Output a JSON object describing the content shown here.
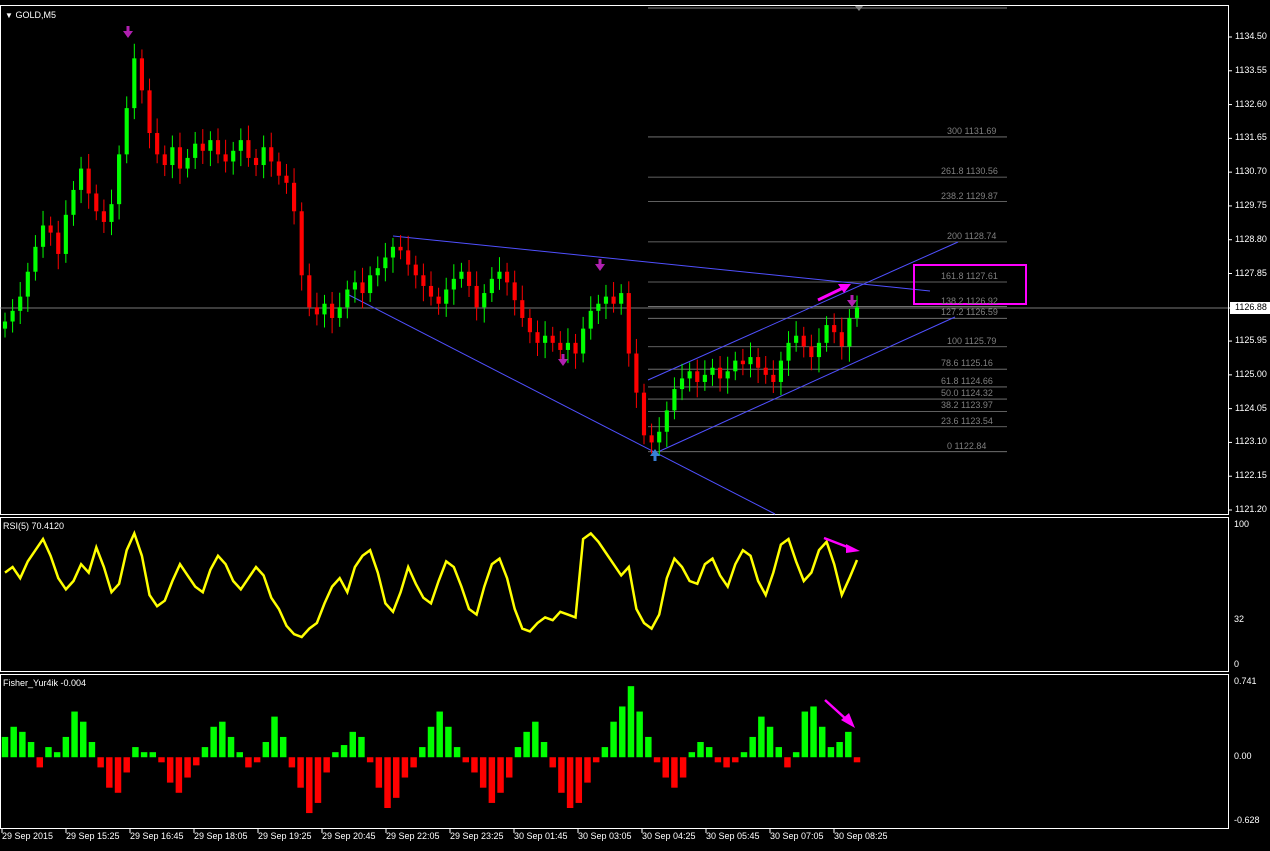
{
  "header": {
    "symbol_label": "GOLD,M5"
  },
  "panels": {
    "rsi": {
      "label": "RSI(5) 70.4120"
    },
    "fisher": {
      "label": "Fisher_Yur4ik -0.004"
    }
  },
  "colors": {
    "bull": "#00ff00",
    "bear": "#ff0000",
    "line": "#5050ff",
    "rsi": "#ffff00",
    "fib": "#7f7f7f",
    "highlight": "#ff00ff",
    "arrow_up": "#3a7fd5",
    "arrow_down": "#b020b0"
  },
  "icons": [
    "dropdown-triangle-icon",
    "up-arrow-marker-icon",
    "down-arrow-marker-icon"
  ],
  "chart_data": [
    {
      "type": "candlestick",
      "title": "GOLD,M5",
      "price_axis_ticks": [
        "1134.50",
        "1133.55",
        "1132.60",
        "1131.65",
        "1130.70",
        "1129.75",
        "1128.80",
        "1127.85",
        "1126.88",
        "1125.95",
        "1125.00",
        "1124.05",
        "1123.10",
        "1122.15",
        "1121.20"
      ],
      "ylim": [
        1121.2,
        1134.5
      ],
      "current_price": "1126.88",
      "time_ticks": [
        "29 Sep 2015",
        "29 Sep 15:25",
        "29 Sep 16:45",
        "29 Sep 18:05",
        "29 Sep 19:25",
        "29 Sep 20:45",
        "29 Sep 22:05",
        "29 Sep 23:25",
        "30 Sep 01:45",
        "30 Sep 03:05",
        "30 Sep 04:25",
        "30 Sep 05:45",
        "30 Sep 07:05",
        "30 Sep 08:25"
      ],
      "closes": [
        1126.5,
        1126.8,
        1127.2,
        1127.9,
        1128.6,
        1129.2,
        1129.0,
        1128.4,
        1129.5,
        1130.2,
        1130.8,
        1130.1,
        1129.6,
        1129.3,
        1129.8,
        1131.2,
        1132.5,
        1133.9,
        1133.0,
        1131.8,
        1131.2,
        1130.9,
        1131.4,
        1130.8,
        1131.1,
        1131.5,
        1131.3,
        1131.6,
        1131.2,
        1131.0,
        1131.3,
        1131.6,
        1131.1,
        1130.9,
        1131.4,
        1131.0,
        1130.6,
        1130.4,
        1129.6,
        1127.8,
        1126.9,
        1126.7,
        1127.0,
        1126.6,
        1126.9,
        1127.4,
        1127.6,
        1127.3,
        1127.8,
        1128.0,
        1128.3,
        1128.6,
        1128.5,
        1128.1,
        1127.8,
        1127.5,
        1127.2,
        1127.0,
        1127.4,
        1127.7,
        1127.9,
        1127.5,
        1126.9,
        1127.3,
        1127.7,
        1127.9,
        1127.6,
        1127.1,
        1126.6,
        1126.2,
        1125.9,
        1126.1,
        1125.9,
        1125.7,
        1125.9,
        1125.6,
        1126.3,
        1126.8,
        1127.0,
        1127.2,
        1127.0,
        1127.3,
        1125.6,
        1124.5,
        1123.3,
        1123.1,
        1123.4,
        1124.0,
        1124.6,
        1124.9,
        1125.1,
        1124.8,
        1125.0,
        1125.2,
        1124.9,
        1125.1,
        1125.4,
        1125.3,
        1125.5,
        1125.2,
        1125.0,
        1124.8,
        1125.4,
        1125.9,
        1126.1,
        1125.8,
        1125.5,
        1125.9,
        1126.4,
        1126.2,
        1125.8,
        1126.6,
        1126.9
      ],
      "fib_levels": [
        {
          "ratio": "300",
          "price": "1131.69"
        },
        {
          "ratio": "261.8",
          "price": "1130.56"
        },
        {
          "ratio": "238.2",
          "price": "1129.87"
        },
        {
          "ratio": "200",
          "price": "1128.74"
        },
        {
          "ratio": "161.8",
          "price": "1127.61"
        },
        {
          "ratio": "138.2",
          "price": "1126.92"
        },
        {
          "ratio": "127.2",
          "price": "1126.59"
        },
        {
          "ratio": "100",
          "price": "1125.79"
        },
        {
          "ratio": "78.6",
          "price": "1125.16"
        },
        {
          "ratio": "61.8",
          "price": "1124.66"
        },
        {
          "ratio": "50.0",
          "price": "1124.32"
        },
        {
          "ratio": "38.2",
          "price": "1123.97"
        },
        {
          "ratio": "23.6",
          "price": "1123.54"
        },
        {
          "ratio": "0",
          "price": "1122.84"
        }
      ]
    },
    {
      "type": "line",
      "title": "RSI(5) 70.4120",
      "ylim": [
        0,
        100
      ],
      "y_ticks": [
        "100",
        "32",
        "0"
      ],
      "values": [
        66,
        70,
        62,
        74,
        82,
        90,
        78,
        62,
        54,
        60,
        72,
        66,
        84,
        70,
        52,
        58,
        82,
        94,
        78,
        50,
        42,
        46,
        60,
        72,
        64,
        56,
        52,
        68,
        78,
        72,
        60,
        54,
        62,
        70,
        64,
        48,
        40,
        28,
        22,
        20,
        26,
        30,
        44,
        56,
        62,
        52,
        70,
        78,
        82,
        66,
        44,
        38,
        52,
        70,
        58,
        48,
        44,
        60,
        74,
        70,
        56,
        40,
        36,
        56,
        72,
        76,
        62,
        40,
        26,
        24,
        30,
        34,
        32,
        38,
        36,
        34,
        90,
        94,
        88,
        80,
        72,
        64,
        70,
        40,
        30,
        26,
        36,
        62,
        76,
        70,
        60,
        58,
        72,
        76,
        64,
        56,
        72,
        82,
        78,
        60,
        50,
        66,
        86,
        90,
        74,
        60,
        66,
        82,
        88,
        72,
        50,
        62,
        75
      ]
    },
    {
      "type": "bar",
      "title": "Fisher_Yur4ik -0.004",
      "ylim": [
        -0.628,
        0.741
      ],
      "y_ticks": [
        "0.741",
        "0.00",
        "-0.628"
      ],
      "values": [
        0.2,
        0.3,
        0.25,
        0.15,
        -0.1,
        0.1,
        0.05,
        0.2,
        0.45,
        0.35,
        0.15,
        -0.1,
        -0.3,
        -0.35,
        -0.15,
        0.1,
        0.05,
        0.05,
        -0.05,
        -0.25,
        -0.35,
        -0.2,
        -0.08,
        0.1,
        0.3,
        0.35,
        0.2,
        0.05,
        -0.1,
        -0.05,
        0.15,
        0.4,
        0.2,
        -0.1,
        -0.3,
        -0.55,
        -0.45,
        -0.15,
        0.05,
        0.12,
        0.25,
        0.2,
        -0.05,
        -0.3,
        -0.5,
        -0.4,
        -0.2,
        -0.1,
        0.1,
        0.3,
        0.45,
        0.3,
        0.1,
        -0.05,
        -0.15,
        -0.3,
        -0.45,
        -0.35,
        -0.2,
        0.1,
        0.25,
        0.35,
        0.15,
        -0.1,
        -0.35,
        -0.5,
        -0.45,
        -0.25,
        -0.05,
        0.1,
        0.35,
        0.5,
        0.7,
        0.45,
        0.2,
        -0.05,
        -0.2,
        -0.3,
        -0.2,
        0.05,
        0.15,
        0.1,
        -0.05,
        -0.1,
        -0.05,
        0.05,
        0.2,
        0.4,
        0.3,
        0.1,
        -0.1,
        0.05,
        0.45,
        0.5,
        0.3,
        0.1,
        0.15,
        0.25,
        -0.05
      ],
      "colors": {
        "positive": "#00ff00",
        "negative": "#ff0000"
      }
    }
  ]
}
